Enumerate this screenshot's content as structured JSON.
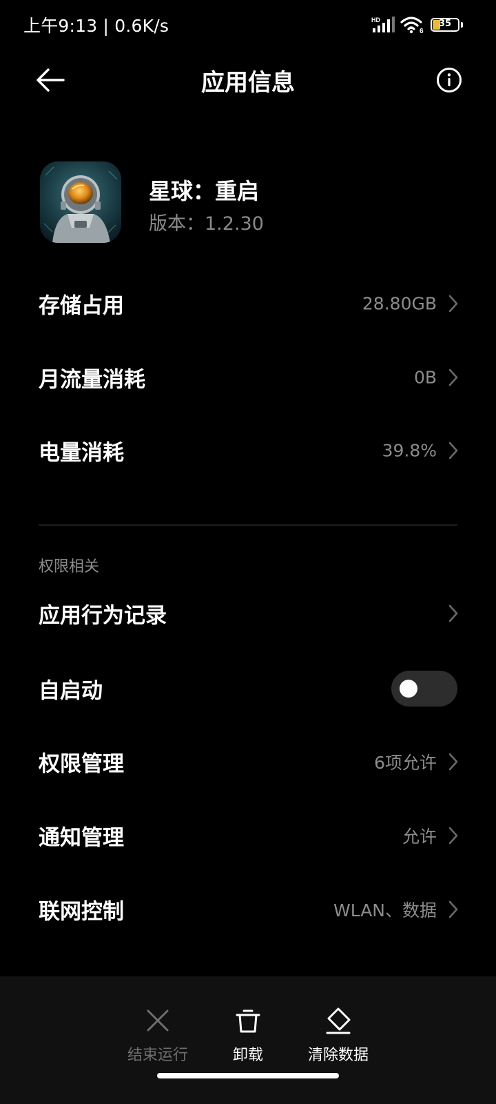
{
  "status_bar": {
    "time_speed": "上午9:13 | 0.6K/s",
    "network_badge": "HD",
    "wifi_badge": "6",
    "battery_level": "35",
    "battery_fraction": 0.35
  },
  "header": {
    "title": "应用信息",
    "back_icon": "back-arrow-icon",
    "info_icon": "info-icon"
  },
  "app": {
    "name": "星球：重启",
    "version": "版本：1.2.30"
  },
  "usage_items": [
    {
      "label": "存储占用",
      "value": "28.80GB"
    },
    {
      "label": "月流量消耗",
      "value": "0B"
    },
    {
      "label": "电量消耗",
      "value": "39.8%"
    }
  ],
  "permissions_section": {
    "title": "权限相关",
    "behavior_record": {
      "label": "应用行为记录"
    },
    "autostart": {
      "label": "自启动",
      "enabled": false
    },
    "items": [
      {
        "label": "权限管理",
        "value": "6项允许"
      },
      {
        "label": "通知管理",
        "value": "允许"
      },
      {
        "label": "联网控制",
        "value": "WLAN、数据"
      }
    ]
  },
  "bottom_actions": [
    {
      "label": "结束运行",
      "icon": "close-icon",
      "enabled": false
    },
    {
      "label": "卸载",
      "icon": "trash-icon",
      "enabled": true
    },
    {
      "label": "清除数据",
      "icon": "eraser-icon",
      "enabled": true
    }
  ],
  "colors": {
    "background": "#000000",
    "text_primary": "#ffffff",
    "text_secondary": "#8c8c8c",
    "bottom_bar": "#111111",
    "toggle_off": "#2d2d2d",
    "battery_fill": "#e8b93c",
    "disabled_action": "#6e6e6e"
  }
}
